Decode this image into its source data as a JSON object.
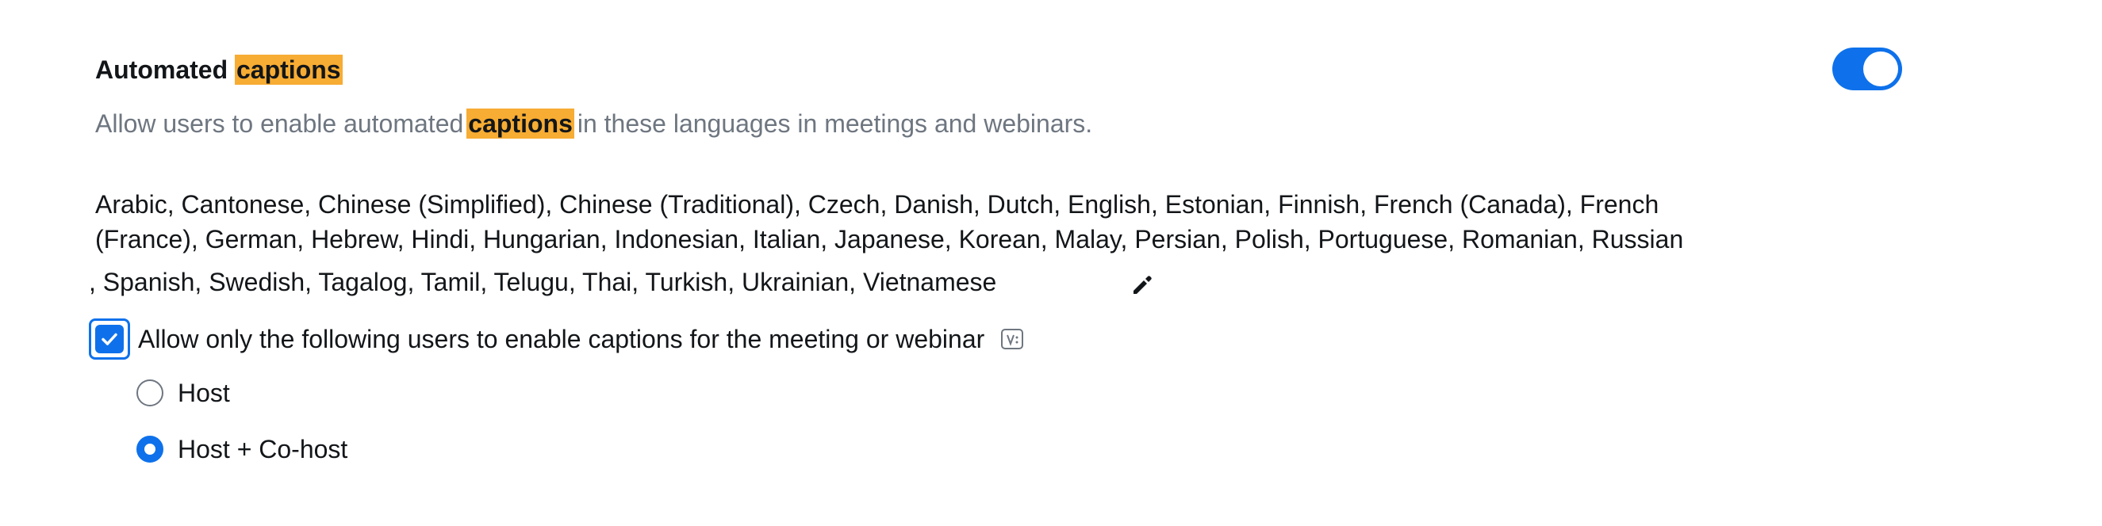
{
  "setting": {
    "title_prefix": "Automated",
    "title_highlight": "captions",
    "description_prefix": "Allow users to enable automated",
    "description_highlight": "captions",
    "description_suffix": "in these languages in meetings and webinars.",
    "enabled": true,
    "languages_line1": "Arabic,  Cantonese,  Chinese (Simplified),  Chinese (Traditional),  Czech,  Danish,  Dutch,  English,  Estonian,  Finnish,  French (Canada),  French",
    "languages_line2": "(France),  German,  Hebrew,  Hindi,  Hungarian,  Indonesian,  Italian,  Japanese,  Korean,  Malay,  Persian,  Polish,  Portuguese,  Romanian,  Russian",
    "languages_line3": ",  Spanish,  Swedish,  Tagalog,  Tamil,  Telugu,  Thai,  Turkish,  Ukrainian,  Vietnamese",
    "restrict_label": "Allow only the following users to enable captions for the meeting or webinar",
    "restrict_checked": true,
    "options": [
      {
        "label": "Host",
        "selected": false
      },
      {
        "label": "Host + Co-host",
        "selected": true
      }
    ]
  },
  "colors": {
    "accent": "#0e71eb",
    "highlight": "#f7ac33",
    "text": "#131619",
    "muted_text": "#6e7680"
  },
  "icons": {
    "edit": "pencil-icon",
    "info": "variable-info-icon",
    "check": "checkmark-icon"
  }
}
